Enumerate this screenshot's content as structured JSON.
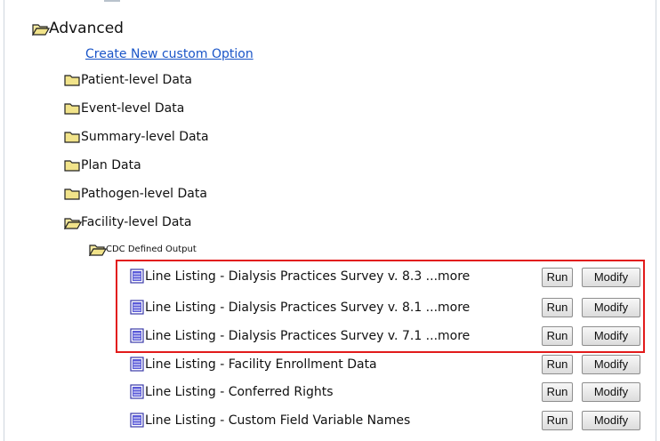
{
  "tree": {
    "advanced_label": "Advanced",
    "create_link": "Create New custom Option",
    "folders": [
      "Patient-level Data",
      "Event-level Data",
      "Summary-level Data",
      "Plan Data",
      "Pathogen-level Data",
      "Facility-level Data"
    ],
    "subfolder": "CDC Defined Output",
    "reports": [
      {
        "label": "Line Listing - Dialysis Practices Survey v. 8.3 ...more"
      },
      {
        "label": "Line Listing - Dialysis Practices Survey v. 8.1 ...more"
      },
      {
        "label": "Line Listing - Dialysis Practices Survey v. 7.1 ...more"
      },
      {
        "label": "Line Listing - Facility Enrollment Data"
      },
      {
        "label": "Line Listing - Conferred Rights"
      },
      {
        "label": "Line Listing - Custom Field Variable Names"
      }
    ],
    "run_label": "Run",
    "modify_label": "Modify"
  },
  "colors": {
    "highlight": "#e21b1b",
    "link": "#1a55c8",
    "folder": "#f1e38a"
  }
}
